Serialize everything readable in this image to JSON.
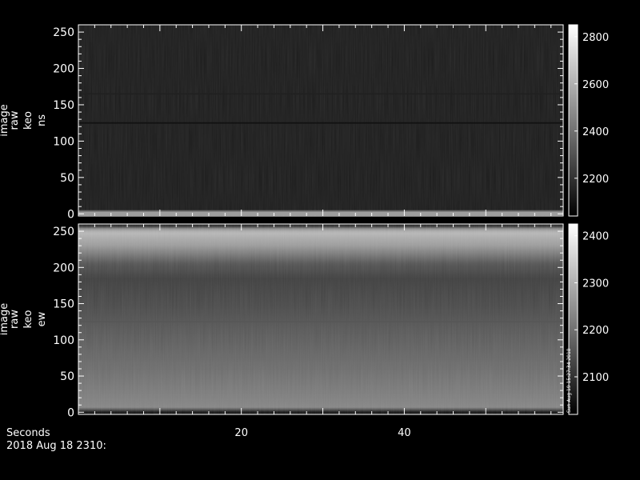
{
  "chart_data": [
    {
      "type": "heatmap",
      "ylabel": [
        "image",
        "raw",
        "keo",
        "ns"
      ],
      "y_ticks": [
        0,
        50,
        100,
        150,
        200,
        250
      ],
      "ylim": [
        -3,
        260
      ],
      "colorbar": {
        "ticks": [
          2200,
          2400,
          2600,
          2800
        ],
        "range": [
          2040,
          2850
        ]
      },
      "bands": [
        {
          "y_center": 1,
          "half_width": 3,
          "level": 0.62
        },
        {
          "y_center": 4,
          "half_width": 1,
          "level": 0.4
        },
        {
          "y_center": 165,
          "half_width": 1,
          "level": 0.13
        },
        {
          "y_center": 125,
          "half_width": 1,
          "level": 0.07
        }
      ],
      "base_level": 0.1,
      "grid": false
    },
    {
      "type": "heatmap",
      "ylabel": [
        "image",
        "raw",
        "keo",
        "ew"
      ],
      "y_ticks": [
        0,
        50,
        100,
        150,
        200,
        250
      ],
      "ylim": [
        -3,
        260
      ],
      "colorbar": {
        "ticks": [
          2100,
          2200,
          2300,
          2400
        ],
        "range": [
          2020,
          2425
        ]
      },
      "profile": [
        [
          -3,
          0.06
        ],
        [
          2,
          0.1
        ],
        [
          5,
          0.52
        ],
        [
          15,
          0.5
        ],
        [
          60,
          0.42
        ],
        [
          100,
          0.36
        ],
        [
          150,
          0.28
        ],
        [
          185,
          0.24
        ],
        [
          205,
          0.32
        ],
        [
          230,
          0.6
        ],
        [
          240,
          0.66
        ],
        [
          248,
          0.72
        ],
        [
          253,
          0.6
        ],
        [
          256,
          0.25
        ],
        [
          260,
          0.1
        ]
      ],
      "bands": [
        {
          "y_center": 125,
          "half_width": 1,
          "level": 0.34
        }
      ],
      "grid": false
    }
  ],
  "x_axis": {
    "label": "Seconds",
    "ticks": [
      20,
      40
    ],
    "range": [
      0,
      59.5
    ]
  },
  "date_label": "2018 Aug 18 2310:",
  "stamp": "Sun Aug 19 15:27:34 2018"
}
